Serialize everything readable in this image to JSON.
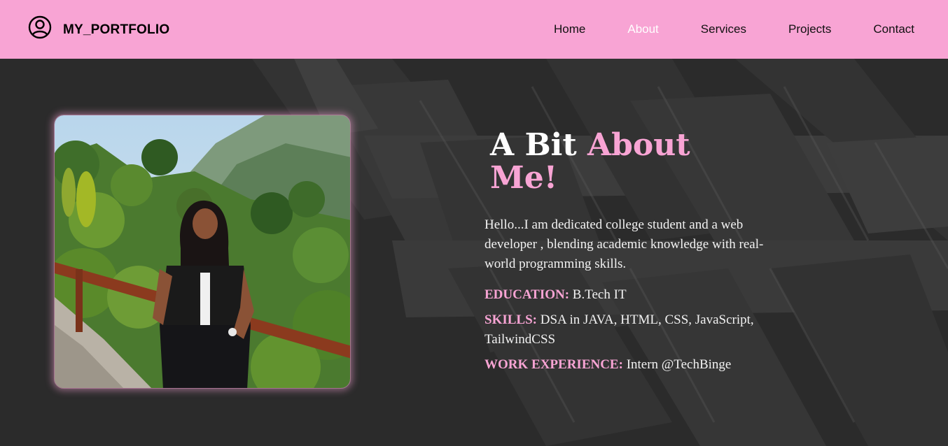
{
  "header": {
    "brand": "MY_PORTFOLIO",
    "brand_icon": "user-circle-icon",
    "bg_color": "#f8a4d4",
    "nav": [
      {
        "label": "Home",
        "active": false
      },
      {
        "label": "About",
        "active": true
      },
      {
        "label": "Services",
        "active": false
      },
      {
        "label": "Projects",
        "active": false
      },
      {
        "label": "Contact",
        "active": false
      }
    ]
  },
  "about": {
    "heading_plain": "A Bit ",
    "heading_accent": "About Me!",
    "intro": "Hello...I am dedicated college student and a web developer , blending academic knowledge with real-world programming skills.",
    "education_label": "EDUCATION:",
    "education_value": " B.Tech IT",
    "skills_label": "SKILLS:",
    "skills_value": " DSA in JAVA, HTML, CSS, JavaScript, TailwindCSS",
    "work_label": "WORK EXPERIENCE:",
    "work_value": " Intern @TechBinge",
    "accent_color": "#f8a4d4"
  },
  "photo": {
    "description_icon": "profile-photo"
  }
}
